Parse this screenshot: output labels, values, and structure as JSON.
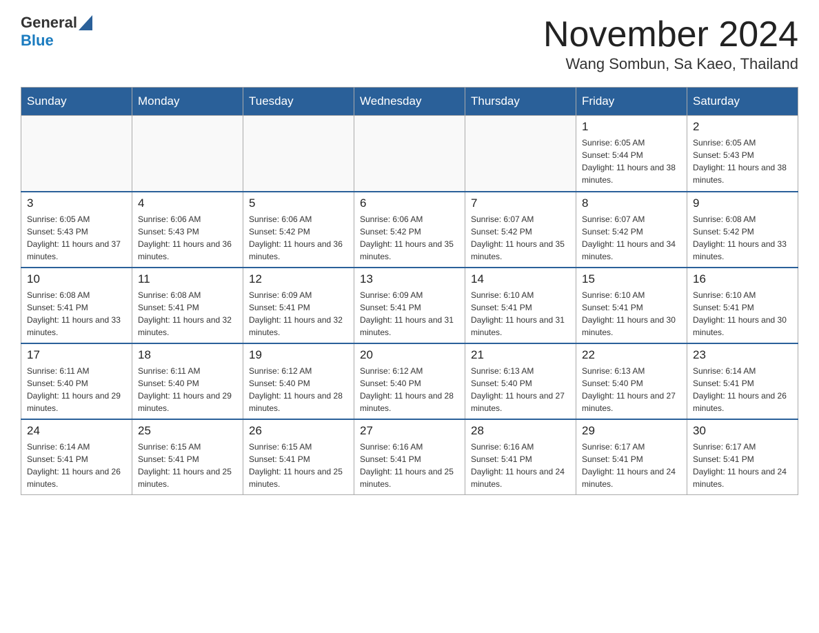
{
  "header": {
    "logo_general": "General",
    "logo_blue": "Blue",
    "month": "November 2024",
    "location": "Wang Sombun, Sa Kaeo, Thailand"
  },
  "weekdays": [
    "Sunday",
    "Monday",
    "Tuesday",
    "Wednesday",
    "Thursday",
    "Friday",
    "Saturday"
  ],
  "weeks": [
    [
      {
        "day": "",
        "info": ""
      },
      {
        "day": "",
        "info": ""
      },
      {
        "day": "",
        "info": ""
      },
      {
        "day": "",
        "info": ""
      },
      {
        "day": "",
        "info": ""
      },
      {
        "day": "1",
        "info": "Sunrise: 6:05 AM\nSunset: 5:44 PM\nDaylight: 11 hours and 38 minutes."
      },
      {
        "day": "2",
        "info": "Sunrise: 6:05 AM\nSunset: 5:43 PM\nDaylight: 11 hours and 38 minutes."
      }
    ],
    [
      {
        "day": "3",
        "info": "Sunrise: 6:05 AM\nSunset: 5:43 PM\nDaylight: 11 hours and 37 minutes."
      },
      {
        "day": "4",
        "info": "Sunrise: 6:06 AM\nSunset: 5:43 PM\nDaylight: 11 hours and 36 minutes."
      },
      {
        "day": "5",
        "info": "Sunrise: 6:06 AM\nSunset: 5:42 PM\nDaylight: 11 hours and 36 minutes."
      },
      {
        "day": "6",
        "info": "Sunrise: 6:06 AM\nSunset: 5:42 PM\nDaylight: 11 hours and 35 minutes."
      },
      {
        "day": "7",
        "info": "Sunrise: 6:07 AM\nSunset: 5:42 PM\nDaylight: 11 hours and 35 minutes."
      },
      {
        "day": "8",
        "info": "Sunrise: 6:07 AM\nSunset: 5:42 PM\nDaylight: 11 hours and 34 minutes."
      },
      {
        "day": "9",
        "info": "Sunrise: 6:08 AM\nSunset: 5:42 PM\nDaylight: 11 hours and 33 minutes."
      }
    ],
    [
      {
        "day": "10",
        "info": "Sunrise: 6:08 AM\nSunset: 5:41 PM\nDaylight: 11 hours and 33 minutes."
      },
      {
        "day": "11",
        "info": "Sunrise: 6:08 AM\nSunset: 5:41 PM\nDaylight: 11 hours and 32 minutes."
      },
      {
        "day": "12",
        "info": "Sunrise: 6:09 AM\nSunset: 5:41 PM\nDaylight: 11 hours and 32 minutes."
      },
      {
        "day": "13",
        "info": "Sunrise: 6:09 AM\nSunset: 5:41 PM\nDaylight: 11 hours and 31 minutes."
      },
      {
        "day": "14",
        "info": "Sunrise: 6:10 AM\nSunset: 5:41 PM\nDaylight: 11 hours and 31 minutes."
      },
      {
        "day": "15",
        "info": "Sunrise: 6:10 AM\nSunset: 5:41 PM\nDaylight: 11 hours and 30 minutes."
      },
      {
        "day": "16",
        "info": "Sunrise: 6:10 AM\nSunset: 5:41 PM\nDaylight: 11 hours and 30 minutes."
      }
    ],
    [
      {
        "day": "17",
        "info": "Sunrise: 6:11 AM\nSunset: 5:40 PM\nDaylight: 11 hours and 29 minutes."
      },
      {
        "day": "18",
        "info": "Sunrise: 6:11 AM\nSunset: 5:40 PM\nDaylight: 11 hours and 29 minutes."
      },
      {
        "day": "19",
        "info": "Sunrise: 6:12 AM\nSunset: 5:40 PM\nDaylight: 11 hours and 28 minutes."
      },
      {
        "day": "20",
        "info": "Sunrise: 6:12 AM\nSunset: 5:40 PM\nDaylight: 11 hours and 28 minutes."
      },
      {
        "day": "21",
        "info": "Sunrise: 6:13 AM\nSunset: 5:40 PM\nDaylight: 11 hours and 27 minutes."
      },
      {
        "day": "22",
        "info": "Sunrise: 6:13 AM\nSunset: 5:40 PM\nDaylight: 11 hours and 27 minutes."
      },
      {
        "day": "23",
        "info": "Sunrise: 6:14 AM\nSunset: 5:41 PM\nDaylight: 11 hours and 26 minutes."
      }
    ],
    [
      {
        "day": "24",
        "info": "Sunrise: 6:14 AM\nSunset: 5:41 PM\nDaylight: 11 hours and 26 minutes."
      },
      {
        "day": "25",
        "info": "Sunrise: 6:15 AM\nSunset: 5:41 PM\nDaylight: 11 hours and 25 minutes."
      },
      {
        "day": "26",
        "info": "Sunrise: 6:15 AM\nSunset: 5:41 PM\nDaylight: 11 hours and 25 minutes."
      },
      {
        "day": "27",
        "info": "Sunrise: 6:16 AM\nSunset: 5:41 PM\nDaylight: 11 hours and 25 minutes."
      },
      {
        "day": "28",
        "info": "Sunrise: 6:16 AM\nSunset: 5:41 PM\nDaylight: 11 hours and 24 minutes."
      },
      {
        "day": "29",
        "info": "Sunrise: 6:17 AM\nSunset: 5:41 PM\nDaylight: 11 hours and 24 minutes."
      },
      {
        "day": "30",
        "info": "Sunrise: 6:17 AM\nSunset: 5:41 PM\nDaylight: 11 hours and 24 minutes."
      }
    ]
  ]
}
